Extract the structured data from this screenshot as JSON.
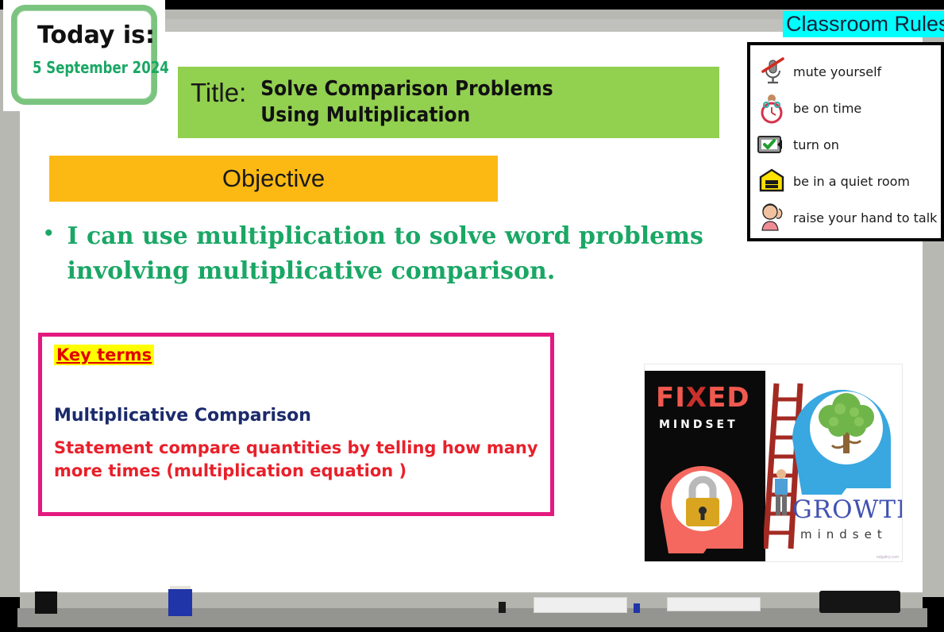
{
  "today_card": {
    "label": "Today  is:",
    "date": "5 September 2024",
    "border_color": "#7bc47f",
    "date_color": "#1aa765"
  },
  "title": {
    "prefix": "Title:",
    "line1": "Solve Comparison Problems",
    "line2": "Using Multiplication",
    "background_color": "#92d050"
  },
  "objective": {
    "heading": "Objective",
    "heading_background": "#fdb913",
    "bullet_symbol": "•",
    "text": "I can use multiplication to solve word problems involving multiplicative comparison.",
    "text_color": "#1aa765"
  },
  "key_terms": {
    "heading": "Key terms",
    "heading_background": "#ffff00",
    "heading_color": "#e00000",
    "term": "Multiplicative Comparison",
    "term_color": "#1b2a6b",
    "definition": "Statement compare quantities by telling how many more times  (multiplication equation )",
    "definition_color": "#e8202a",
    "border_color": "#e3197f"
  },
  "classroom_rules": {
    "title": "Classroom Rules",
    "title_background": "#00ffff",
    "items": [
      {
        "icon": "muted-microphone-icon",
        "label": "mute yourself"
      },
      {
        "icon": "clock-icon",
        "label": "be on time"
      },
      {
        "icon": "video-on-icon",
        "label": "turn on"
      },
      {
        "icon": "quiet-zone-sign-icon",
        "label": "be in a quiet room"
      },
      {
        "icon": "raise-hand-icon",
        "label": "raise your hand to talk"
      }
    ]
  },
  "mindset_image": {
    "fixed_word_part1": "FI",
    "fixed_word_part2": "X",
    "fixed_word_part3": "ED",
    "fixed_subtitle": "MINDSET",
    "growth_word": "GROWTH",
    "growth_subtitle": "mindset",
    "credit": "edgaliry.com"
  },
  "whiteboard": {
    "frame_color": "#b8b8b3",
    "surface_color": "#ffffff",
    "tray_color": "#949490"
  }
}
